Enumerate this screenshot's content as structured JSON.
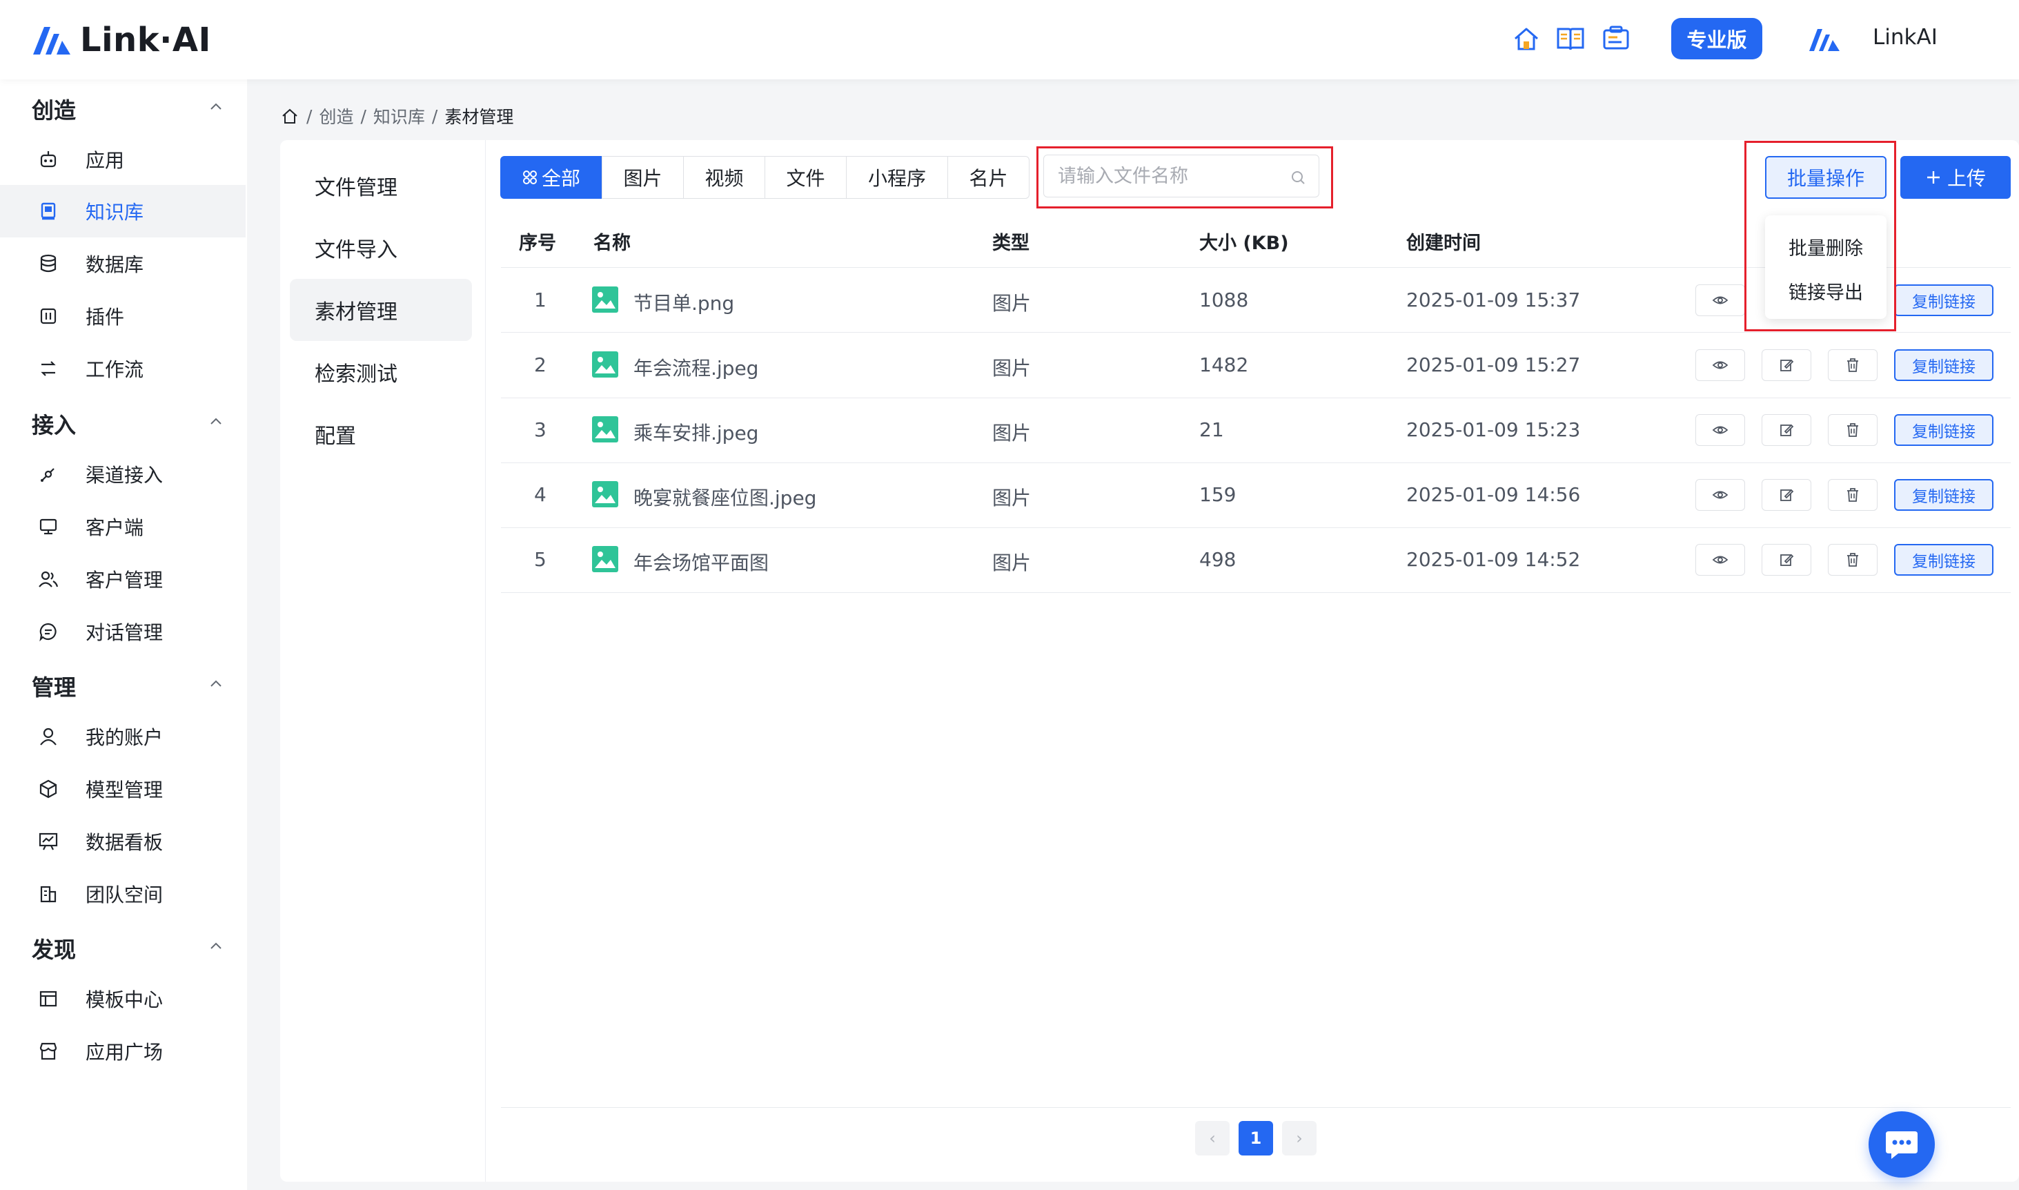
{
  "header": {
    "logo_text": "Link·AI",
    "pro_badge": "专业版",
    "user_name": "LinkAI",
    "icons": [
      "home-icon",
      "book-icon",
      "card-icon"
    ],
    "brand_color": "#2468f2"
  },
  "sidebar": {
    "sections": [
      {
        "title": "创造",
        "items": [
          "应用",
          "知识库",
          "数据库",
          "插件",
          "工作流"
        ]
      },
      {
        "title": "接入",
        "items": [
          "渠道接入",
          "客户端",
          "客户管理",
          "对话管理"
        ]
      },
      {
        "title": "管理",
        "items": [
          "我的账户",
          "模型管理",
          "数据看板",
          "团队空间"
        ]
      },
      {
        "title": "发现",
        "items": [
          "模板中心",
          "应用广场"
        ]
      }
    ],
    "active_item": "知识库"
  },
  "breadcrumb": [
    "创造",
    "知识库",
    "素材管理"
  ],
  "kb_nav": {
    "items": [
      "文件管理",
      "文件导入",
      "素材管理",
      "检索测试",
      "配置"
    ],
    "active": "素材管理"
  },
  "filters": {
    "tabs": [
      "全部",
      "图片",
      "视频",
      "文件",
      "小程序",
      "名片"
    ],
    "active": "全部"
  },
  "search": {
    "placeholder": "请输入文件名称",
    "value": ""
  },
  "toolbar": {
    "batch_label": "批量操作",
    "upload_label": "上传",
    "dropdown": [
      "批量删除",
      "链接导出"
    ]
  },
  "table": {
    "headers": [
      "序号",
      "名称",
      "类型",
      "大小 (KB)",
      "创建时间"
    ],
    "rows": [
      {
        "index": "1",
        "name": "节目单.png",
        "type": "图片",
        "size": "1088",
        "created": "2025-01-09 15:37"
      },
      {
        "index": "2",
        "name": "年会流程.jpeg",
        "type": "图片",
        "size": "1482",
        "created": "2025-01-09 15:27"
      },
      {
        "index": "3",
        "name": "乘车安排.jpeg",
        "type": "图片",
        "size": "21",
        "created": "2025-01-09 15:23"
      },
      {
        "index": "4",
        "name": "晚宴就餐座位图.jpeg",
        "type": "图片",
        "size": "159",
        "created": "2025-01-09 14:56"
      },
      {
        "index": "5",
        "name": "年会场馆平面图",
        "type": "图片",
        "size": "498",
        "created": "2025-01-09 14:52"
      }
    ],
    "copy_label": "复制链接"
  },
  "pagination": {
    "current": "1",
    "prev": "‹",
    "next": "›"
  }
}
